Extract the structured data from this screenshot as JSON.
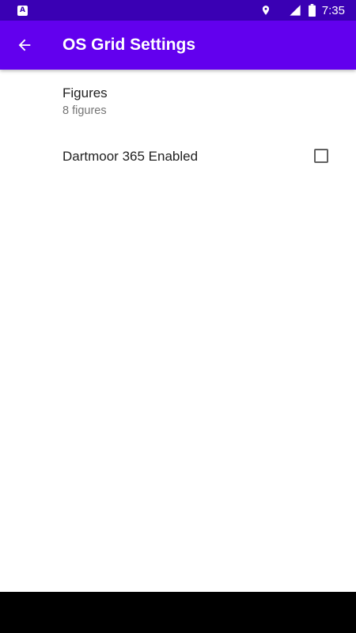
{
  "status_bar": {
    "time": "7:35",
    "icons": [
      "a-icon",
      "location-icon",
      "signal-icon",
      "battery-icon"
    ],
    "notification_letter": "A",
    "background_color": "#3a00b4"
  },
  "app_bar": {
    "title": "OS Grid Settings",
    "back_icon": "arrow-back-icon",
    "background_color": "#6200ee"
  },
  "preferences": [
    {
      "title": "Figures",
      "summary": "8 figures"
    },
    {
      "title": "Dartmoor 365 Enabled",
      "checked": false
    }
  ]
}
